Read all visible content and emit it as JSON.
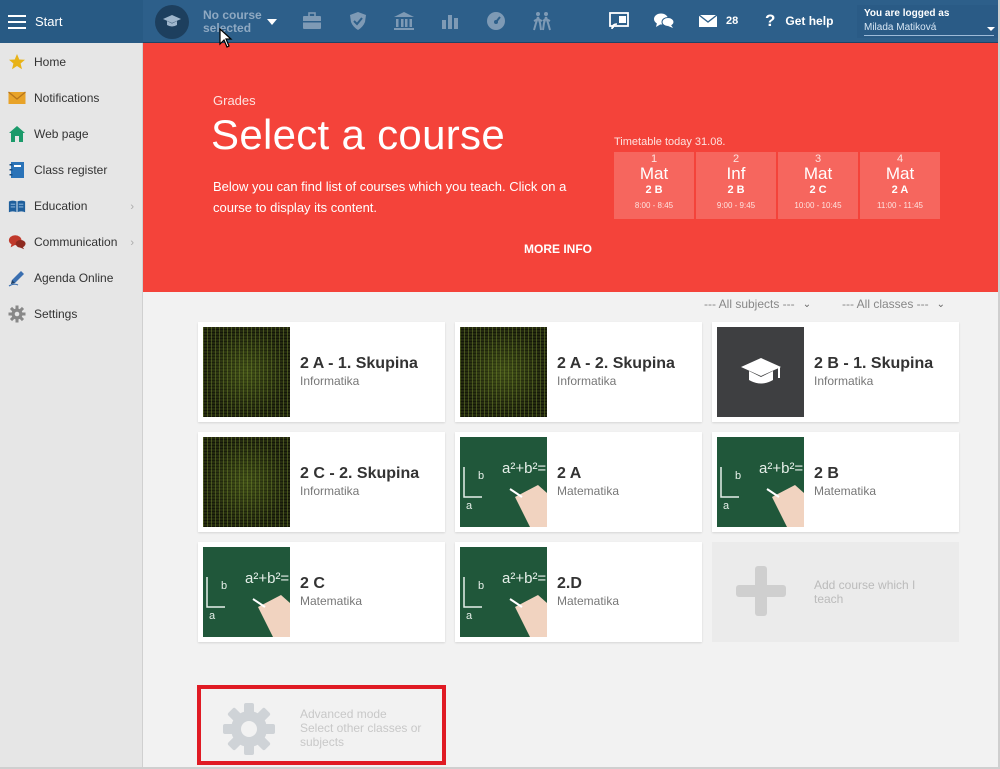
{
  "topbar": {
    "start_label": "Start",
    "course_selector": "No course selected",
    "mail_count": "28",
    "help_label": "Get help",
    "logged_label": "You are logged as",
    "user_name": "Milada Matiková",
    "icons": [
      "briefcase-icon",
      "shield-icon",
      "bank-icon",
      "bar-chart-icon",
      "dashboard-icon",
      "people-walking-icon",
      "cast-icon",
      "chat-icon",
      "mail-icon",
      "help-icon"
    ]
  },
  "sidebar": {
    "items": [
      {
        "label": "Home",
        "icon": "star-icon"
      },
      {
        "label": "Notifications",
        "icon": "envelope-icon"
      },
      {
        "label": "Web page",
        "icon": "house-icon"
      },
      {
        "label": "Class register",
        "icon": "notebook-icon"
      },
      {
        "label": "Education",
        "icon": "book-icon",
        "submenu": true
      },
      {
        "label": "Communication",
        "icon": "chat-bubbles-icon",
        "submenu": true
      },
      {
        "label": "Agenda Online",
        "icon": "pencil-icon"
      },
      {
        "label": "Settings",
        "icon": "gear-icon"
      }
    ]
  },
  "hero": {
    "subtitle": "Grades",
    "title": "Select a course",
    "description": "Below you can find list of courses which you teach. Click on a course to display its content.",
    "more_info": "MORE INFO",
    "background": "#f4433a"
  },
  "timetable": {
    "caption": "Timetable today 31.08.",
    "slots": [
      {
        "num": "1",
        "subject": "Mat",
        "class": "2 B",
        "time": "8:00 - 8:45"
      },
      {
        "num": "2",
        "subject": "Inf",
        "class": "2 B",
        "time": "9:00 - 9:45"
      },
      {
        "num": "3",
        "subject": "Mat",
        "class": "2 C",
        "time": "10:00 - 10:45"
      },
      {
        "num": "4",
        "subject": "Mat",
        "class": "2 A",
        "time": "11:00 - 11:45"
      }
    ]
  },
  "filters": {
    "subjects": "--- All subjects ---",
    "classes": "--- All classes ---"
  },
  "courses": [
    {
      "title": "2 A - 1. Skupina",
      "subject": "Informatika",
      "image": "matrix"
    },
    {
      "title": "2 A - 2. Skupina",
      "subject": "Informatika",
      "image": "matrix"
    },
    {
      "title": "2 B - 1. Skupina",
      "subject": "Informatika",
      "image": "graduation-cap"
    },
    {
      "title": "2 C - 2. Skupina",
      "subject": "Informatika",
      "image": "matrix"
    },
    {
      "title": "2 A",
      "subject": "Matematika",
      "image": "chalkboard"
    },
    {
      "title": "2 B",
      "subject": "Matematika",
      "image": "chalkboard"
    },
    {
      "title": "2 C",
      "subject": "Matematika",
      "image": "chalkboard"
    },
    {
      "title": "2.D",
      "subject": "Matematika",
      "image": "chalkboard"
    }
  ],
  "add_course": {
    "label": "Add course which I teach"
  },
  "advanced": {
    "title": "Advanced mode",
    "desc": "Select other classes or subjects",
    "highlight_color": "#e01b24"
  }
}
